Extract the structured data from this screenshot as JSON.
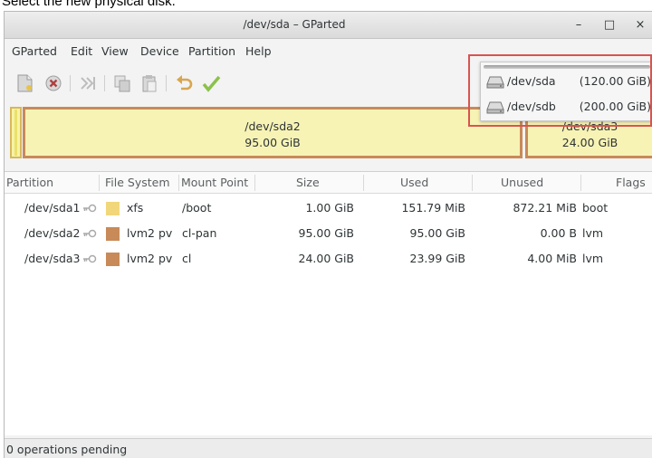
{
  "caption": "Select the new physical disk.",
  "window": {
    "title": "/dev/sda – GParted",
    "minimize_label": "–",
    "maximize_label": "□",
    "close_label": "×"
  },
  "menu": [
    "GParted",
    "Edit",
    "View",
    "Device",
    "Partition",
    "Help"
  ],
  "toolbar": {
    "icons": [
      "new-partition-icon",
      "delete-icon",
      "resize-move-icon",
      "copy-icon",
      "paste-icon",
      "undo-icon",
      "apply-icon"
    ]
  },
  "devices": [
    {
      "name": "/dev/sda",
      "size": "(120.00 GiB)"
    },
    {
      "name": "/dev/sdb",
      "size": "(200.00 GiB)"
    }
  ],
  "diskmap": {
    "segments": [
      {
        "name": "/dev/sda2",
        "size": "95.00 GiB"
      },
      {
        "name": "/dev/sda3",
        "size": "24.00 GiB"
      }
    ]
  },
  "table": {
    "headers": [
      "Partition",
      "File System",
      "Mount Point",
      "Size",
      "Used",
      "Unused",
      "Flags"
    ],
    "rows": [
      {
        "partition": "/dev/sda1",
        "fs": "xfs",
        "fs_color": "#f2d77a",
        "mount": "/boot",
        "size": "1.00 GiB",
        "used": "151.79 MiB",
        "unused": "872.21 MiB",
        "flags": "boot"
      },
      {
        "partition": "/dev/sda2",
        "fs": "lvm2 pv",
        "fs_color": "#c88a58",
        "mount": "cl-pan",
        "size": "95.00 GiB",
        "used": "95.00 GiB",
        "unused": "0.00 B",
        "flags": "lvm"
      },
      {
        "partition": "/dev/sda3",
        "fs": "lvm2 pv",
        "fs_color": "#c88a58",
        "mount": "cl",
        "size": "24.00 GiB",
        "used": "23.99 GiB",
        "unused": "4.00 MiB",
        "flags": "lvm"
      }
    ]
  },
  "status": "0 operations pending",
  "colors": {
    "highlight": "#d9534f",
    "partition_fill": "#f7f3b5",
    "lvm_border": "#c88a58"
  }
}
